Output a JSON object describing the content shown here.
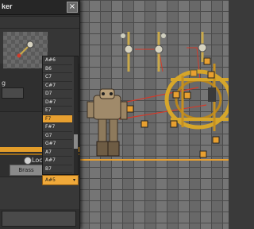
{
  "window": {
    "title_fragment": "ker",
    "close_glyph": "×",
    "label_fragment": "g"
  },
  "options": {
    "local_label": "Local",
    "material_button": "Brass"
  },
  "dropdown": {
    "items": [
      "A#6",
      "B6",
      "C7",
      "C#7",
      "D7",
      "D#7",
      "E7",
      "F7",
      "F#7",
      "G7",
      "G#7",
      "A7",
      "A#7",
      "B7"
    ],
    "selected_index": 7,
    "selected_value": "A#5",
    "caret_glyph": "▾"
  },
  "colors": {
    "accent": "#e8a030",
    "world_stone": "#6e6e6e",
    "panel_bg": "#2f2f2f",
    "wire_red": "#d23a2a"
  },
  "icons": {
    "close": "close-icon",
    "caret": "chevron-down-icon",
    "preview": "speaker-preview-icon"
  }
}
